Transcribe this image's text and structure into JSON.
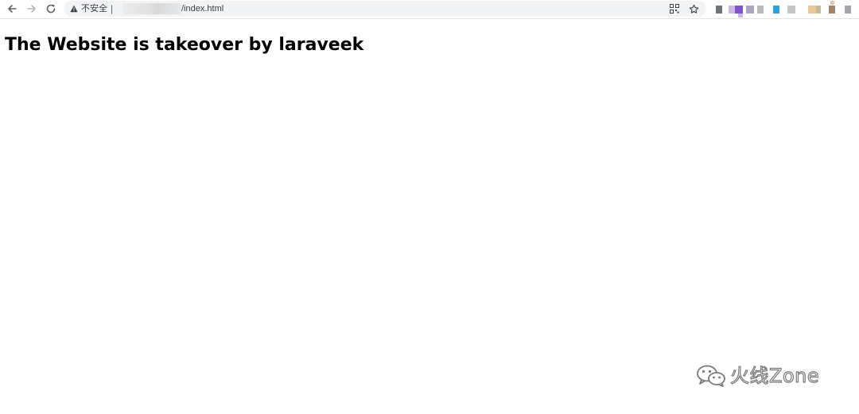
{
  "browser": {
    "security_label": "不安全",
    "url_path": "/index.html",
    "icons": {
      "back": "arrow-left-icon",
      "forward": "arrow-right-icon",
      "reload": "reload-icon",
      "warning": "warning-triangle-icon",
      "qr": "qr-code-icon",
      "bookmark": "star-icon"
    }
  },
  "page": {
    "heading": "The Website is takeover by laraveek"
  },
  "watermark": {
    "text": "火线Zone",
    "icon": "wechat-icon"
  },
  "colors": {
    "omnibox": "#f1f3f4",
    "toolbar_icon": "#5f6368",
    "heading": "#000000",
    "watermark_stroke": "#7a7a7a"
  }
}
